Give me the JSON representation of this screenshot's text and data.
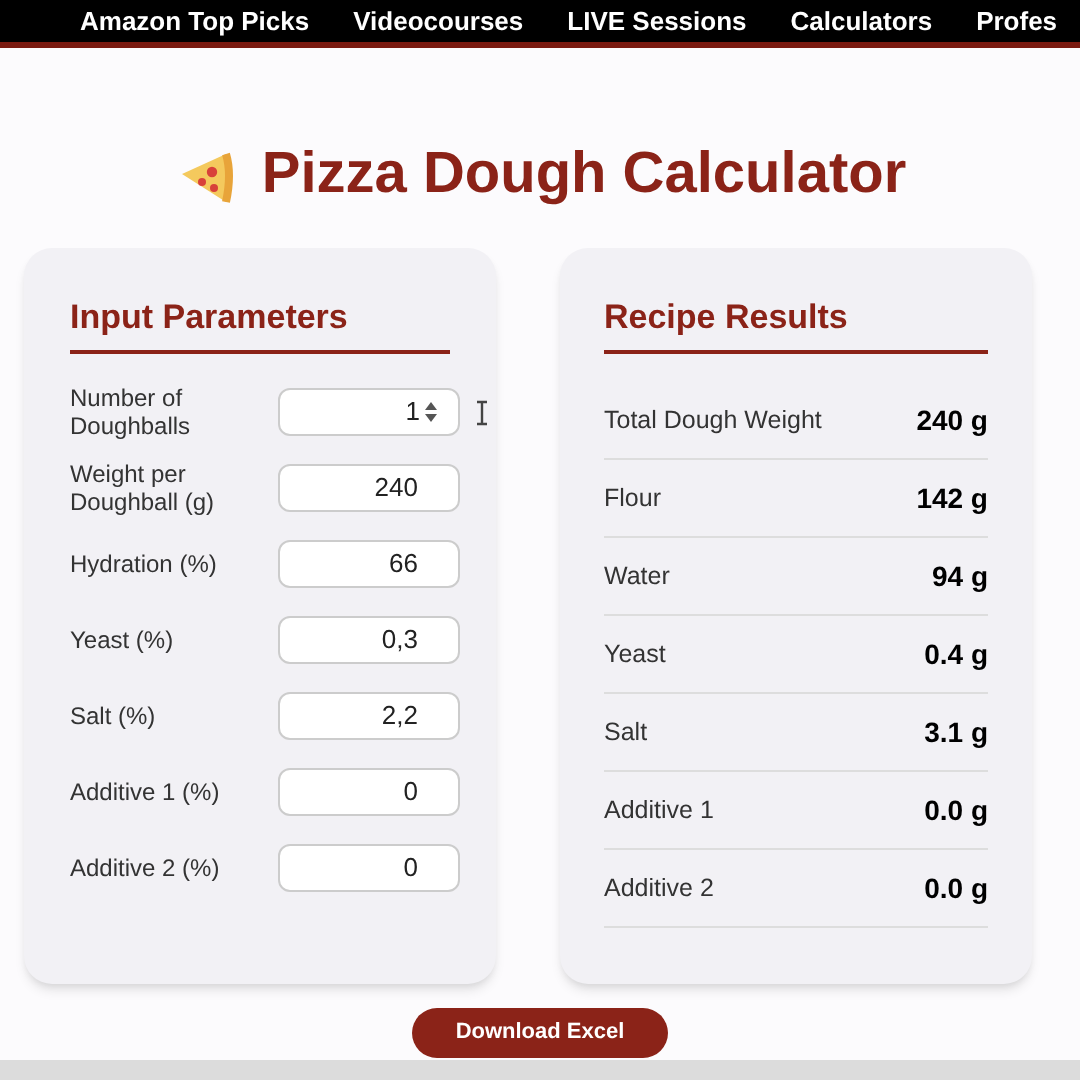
{
  "nav": [
    "Amazon Top Picks",
    "Videocourses",
    "LIVE Sessions",
    "Calculators",
    "Profes"
  ],
  "title": "Pizza Dough Calculator",
  "inputs": {
    "heading": "Input Parameters",
    "fields": [
      {
        "label": "Number of Doughballs",
        "value": "1",
        "kind": "spinner"
      },
      {
        "label": "Weight per Doughball (g)",
        "value": "240",
        "kind": "plain"
      },
      {
        "label": "Hydration (%)",
        "value": "66",
        "kind": "plain"
      },
      {
        "label": "Yeast (%)",
        "value": "0,3",
        "kind": "plain"
      },
      {
        "label": "Salt (%)",
        "value": "2,2",
        "kind": "plain"
      },
      {
        "label": "Additive 1 (%)",
        "value": "0",
        "kind": "plain"
      },
      {
        "label": "Additive 2 (%)",
        "value": "0",
        "kind": "plain"
      }
    ]
  },
  "results": {
    "heading": "Recipe Results",
    "rows": [
      {
        "label": "Total Dough Weight",
        "value": "240 g"
      },
      {
        "label": "Flour",
        "value": "142 g"
      },
      {
        "label": "Water",
        "value": "94 g"
      },
      {
        "label": "Yeast",
        "value": "0.4 g"
      },
      {
        "label": "Salt",
        "value": "3.1 g"
      },
      {
        "label": "Additive 1",
        "value": "0.0 g"
      },
      {
        "label": "Additive 2",
        "value": "0.0 g"
      }
    ]
  },
  "download_button": "Download Excel"
}
